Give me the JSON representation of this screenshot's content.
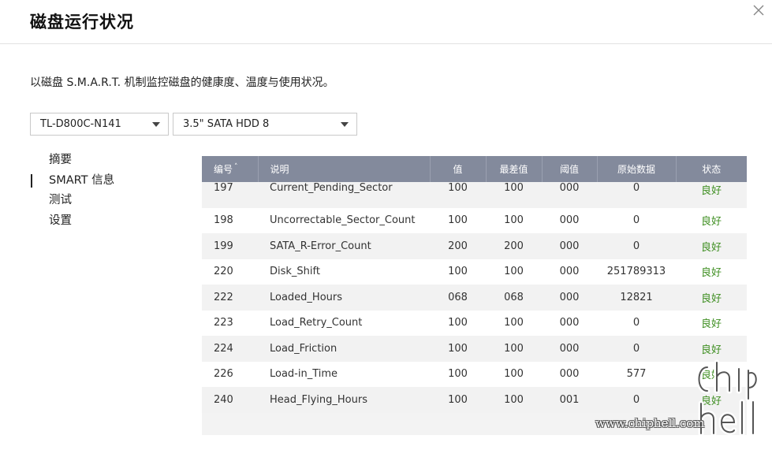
{
  "dialog": {
    "title": "磁盘运行状况",
    "description": "以磁盘 S.M.A.R.T. 机制监控磁盘的健康度、温度与使用状况。"
  },
  "selects": {
    "enclosure": "TL-D800C-N141",
    "disk": "3.5\" SATA HDD 8"
  },
  "nav": {
    "items": [
      {
        "label": "摘要",
        "active": false
      },
      {
        "label": "SMART 信息",
        "active": true
      },
      {
        "label": "测试",
        "active": false
      },
      {
        "label": "设置",
        "active": false
      }
    ]
  },
  "table": {
    "headers": [
      "编号",
      "说明",
      "值",
      "最差值",
      "阈值",
      "原始数据",
      "状态"
    ],
    "sort_indicator": "˄",
    "rows": [
      [
        "197",
        "Current_Pending_Sector",
        "100",
        "100",
        "000",
        "0",
        "良好"
      ],
      [
        "198",
        "Uncorrectable_Sector_Count",
        "100",
        "100",
        "000",
        "0",
        "良好"
      ],
      [
        "199",
        "SATA_R-Error_Count",
        "200",
        "200",
        "000",
        "0",
        "良好"
      ],
      [
        "220",
        "Disk_Shift",
        "100",
        "100",
        "000",
        "251789313",
        "良好"
      ],
      [
        "222",
        "Loaded_Hours",
        "068",
        "068",
        "000",
        "12821",
        "良好"
      ],
      [
        "223",
        "Load_Retry_Count",
        "100",
        "100",
        "000",
        "0",
        "良好"
      ],
      [
        "224",
        "Load_Friction",
        "100",
        "100",
        "000",
        "0",
        "良好"
      ],
      [
        "226",
        "Load-in_Time",
        "100",
        "100",
        "000",
        "577",
        "良好"
      ],
      [
        "240",
        "Head_Flying_Hours",
        "100",
        "100",
        "001",
        "0",
        "良好"
      ]
    ]
  },
  "watermark": {
    "url": "www.chiphell.com",
    "logo": "chiphell"
  },
  "colors": {
    "header_bg": "#838a9c",
    "status_good": "#3f8f22"
  },
  "icons": {
    "close": "close-icon",
    "dropdown": "caret-down-icon"
  }
}
